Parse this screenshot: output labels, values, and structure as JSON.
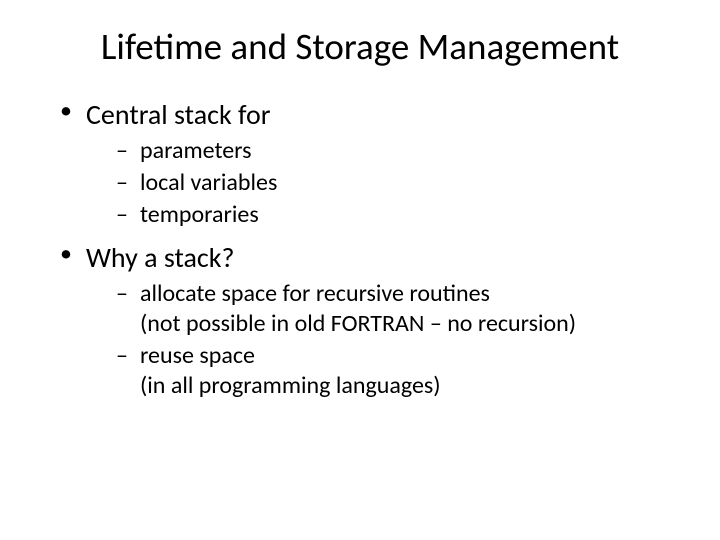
{
  "title": "Lifetime and Storage Management",
  "bullets": [
    {
      "text": "Central stack for",
      "children": [
        {
          "text": "parameters"
        },
        {
          "text": "local variables"
        },
        {
          "text": "temporaries"
        }
      ]
    },
    {
      "text": "Why a stack?",
      "children": [
        {
          "text": "allocate space for recursive routines",
          "sub": "(not possible in old FORTRAN – no recursion)"
        },
        {
          "text": "reuse space",
          "sub": "(in all programming languages)"
        }
      ]
    }
  ]
}
